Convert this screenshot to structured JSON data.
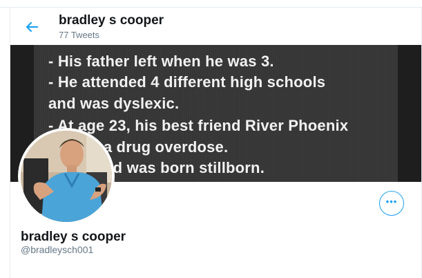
{
  "header": {
    "title": "bradley s cooper",
    "tweet_count": "77 Tweets",
    "back_icon": "arrow-left-icon",
    "accent": "#1da1f2"
  },
  "banner": {
    "lines": [
      "- His father left when he was 3.",
      "- He attended 4 different high schools",
      "and was dyslexic.",
      "- At age 23, his best friend River Phoenix",
      "died of a drug overdose.",
      "- His child was born stillborn."
    ]
  },
  "profile": {
    "name": "bradley s cooper",
    "handle": "@bradleysch001",
    "more_icon": "more-horizontal-icon"
  }
}
